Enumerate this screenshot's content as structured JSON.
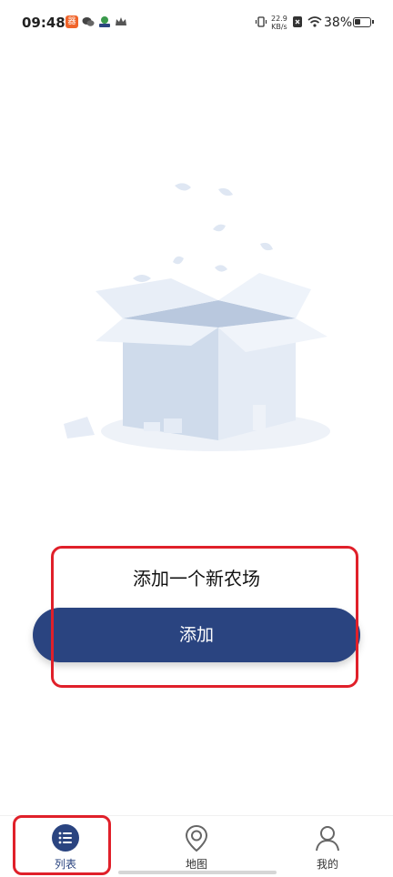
{
  "status_bar": {
    "time": "09:48",
    "net_speed_value": "22.9",
    "net_speed_unit": "KB/s",
    "battery": "38%",
    "battery_level": 0.38,
    "app_badge": "器"
  },
  "empty_state": {
    "message": "添加一个新农场",
    "add_button_label": "添加"
  },
  "bottom_nav": {
    "items": [
      {
        "label": "列表",
        "icon": "list-icon",
        "active": true
      },
      {
        "label": "地图",
        "icon": "map-pin-icon",
        "active": false
      },
      {
        "label": "我的",
        "icon": "user-icon",
        "active": false
      }
    ]
  },
  "colors": {
    "primary": "#2a4480",
    "highlight": "#e0202a",
    "illustration": "#dfe7f3"
  }
}
